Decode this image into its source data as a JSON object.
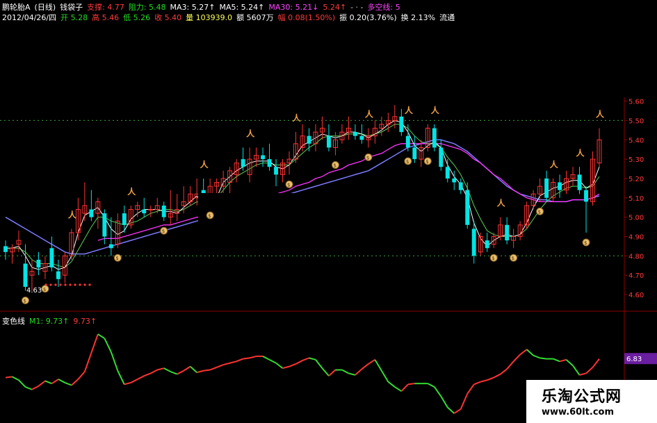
{
  "header": {
    "row1": [
      {
        "text": "鹏轮胎A",
        "color": "#ffffff"
      },
      {
        "text": "(日线)",
        "color": "#ffffff"
      },
      {
        "text": "钱袋子",
        "color": "#ffffff"
      },
      {
        "text": "支撑: 4.77",
        "color": "#ff3b3b"
      },
      {
        "text": "阻力: 5.48",
        "color": "#22dd22"
      },
      {
        "text": "MA3: 5.27↑",
        "color": "#ffffff"
      },
      {
        "text": "MA5: 5.24↑",
        "color": "#ffffff"
      },
      {
        "text": "MA30: 5.21↓",
        "color": "#ff44ff"
      },
      {
        "text": "5.24↑",
        "color": "#ff3b3b"
      },
      {
        "text": "- · -",
        "color": "#cccccc"
      },
      {
        "text": "多空线: 5",
        "color": "#ff44ff"
      }
    ],
    "row2": [
      {
        "text": "2012/04/26/四",
        "color": "#ffffff"
      },
      {
        "text": "开 5.28",
        "color": "#22dd22"
      },
      {
        "text": "高 5.46",
        "color": "#ff3b3b"
      },
      {
        "text": "低 5.26",
        "color": "#22dd22"
      },
      {
        "text": "收 5.40",
        "color": "#ff3b3b"
      },
      {
        "text": "量 103939.0",
        "color": "#ffff55"
      },
      {
        "text": "额 5607万",
        "color": "#ffffff"
      },
      {
        "text": "幅 0.08(1.50%)",
        "color": "#ff3b3b"
      },
      {
        "text": "振 0.20(3.76%)",
        "color": "#ffffff"
      },
      {
        "text": "换 2.13%",
        "color": "#ffffff"
      },
      {
        "text": "流通",
        "color": "#ffffff"
      }
    ]
  },
  "indicator_header": [
    {
      "text": "变色线",
      "color": "#ffffff"
    },
    {
      "text": "M1: 9.73↑",
      "color": "#22dd22"
    },
    {
      "text": "9.73↑",
      "color": "#ff3b3b"
    }
  ],
  "watermark": {
    "title": "乐淘公式网",
    "url": "www.60lt.com"
  },
  "colors": {
    "up": "#ff3333",
    "down": "#00e5e5",
    "ma_white": "#ffffff",
    "ma_green": "#5bd35b",
    "ma_magenta": "#ff33ff",
    "ma_blue": "#7b7bff",
    "grid": "#8b0000"
  },
  "icons": {
    "buy": "running-man-icon",
    "sell": "money-bag-icon"
  },
  "chart_data": [
    {
      "type": "candlestick",
      "title": "",
      "y_ticks": [
        5.6,
        5.5,
        5.4,
        5.3,
        5.2,
        5.1,
        5.0,
        4.9,
        4.8,
        4.7,
        4.6
      ],
      "ylim": [
        4.55,
        5.62
      ],
      "extra_labels": [
        {
          "text": "4.63"
        }
      ],
      "candles": [
        [
          4.85,
          4.88,
          4.78,
          4.82
        ],
        [
          4.82,
          4.86,
          4.76,
          4.84
        ],
        [
          4.86,
          4.93,
          4.82,
          4.88
        ],
        [
          4.76,
          4.86,
          4.62,
          4.64
        ],
        [
          4.7,
          4.78,
          4.62,
          4.72
        ],
        [
          4.78,
          4.82,
          4.7,
          4.74
        ],
        [
          4.72,
          4.8,
          4.68,
          4.76
        ],
        [
          4.84,
          4.9,
          4.72,
          4.74
        ],
        [
          4.72,
          4.78,
          4.64,
          4.68
        ],
        [
          4.7,
          4.82,
          4.66,
          4.8
        ],
        [
          4.8,
          4.94,
          4.78,
          4.92
        ],
        [
          4.92,
          5.1,
          4.88,
          5.04
        ],
        [
          5.02,
          5.18,
          4.98,
          5.06
        ],
        [
          5.04,
          5.14,
          4.98,
          5.0
        ],
        [
          5.02,
          5.1,
          4.94,
          5.08
        ],
        [
          5.02,
          5.04,
          4.86,
          4.9
        ],
        [
          4.86,
          5.0,
          4.8,
          4.84
        ],
        [
          4.86,
          5.02,
          4.84,
          4.98
        ],
        [
          5.02,
          5.06,
          4.92,
          4.96
        ],
        [
          4.96,
          5.06,
          4.94,
          5.04
        ],
        [
          5.04,
          5.08,
          5.0,
          5.06
        ],
        [
          5.04,
          5.1,
          5.0,
          5.02
        ],
        [
          5.04,
          5.06,
          5.0,
          5.04
        ],
        [
          5.04,
          5.1,
          5.02,
          5.06
        ],
        [
          5.06,
          5.08,
          4.98,
          5.0
        ],
        [
          5.0,
          5.14,
          4.96,
          5.02
        ],
        [
          5.02,
          5.12,
          4.98,
          5.04
        ],
        [
          5.06,
          5.16,
          5.02,
          5.08
        ],
        [
          5.08,
          5.16,
          5.06,
          5.12
        ],
        [
          5.1,
          5.2,
          5.06,
          5.12
        ],
        [
          5.14,
          5.2,
          5.04,
          4.96
        ],
        [
          5.1,
          5.2,
          5.06,
          5.16
        ],
        [
          5.16,
          5.2,
          5.12,
          5.18
        ],
        [
          5.16,
          5.24,
          5.12,
          5.2
        ],
        [
          5.18,
          5.26,
          5.1,
          5.24
        ],
        [
          5.22,
          5.3,
          5.18,
          5.28
        ],
        [
          5.3,
          5.36,
          5.24,
          5.26
        ],
        [
          5.22,
          5.36,
          5.18,
          5.3
        ],
        [
          5.3,
          5.36,
          5.26,
          5.32
        ],
        [
          5.32,
          5.36,
          5.26,
          5.3
        ],
        [
          5.3,
          5.38,
          5.24,
          5.26
        ],
        [
          5.26,
          5.3,
          5.16,
          5.22
        ],
        [
          5.22,
          5.3,
          5.18,
          5.28
        ],
        [
          5.28,
          5.34,
          5.22,
          5.3
        ],
        [
          5.3,
          5.44,
          5.28,
          5.38
        ],
        [
          5.36,
          5.48,
          5.34,
          5.42
        ],
        [
          5.42,
          5.46,
          5.34,
          5.38
        ],
        [
          5.38,
          5.48,
          5.34,
          5.44
        ],
        [
          5.44,
          5.52,
          5.4,
          5.46
        ],
        [
          5.42,
          5.48,
          5.34,
          5.36
        ],
        [
          5.36,
          5.44,
          5.32,
          5.4
        ],
        [
          5.4,
          5.48,
          5.38,
          5.44
        ],
        [
          5.44,
          5.52,
          5.4,
          5.46
        ],
        [
          5.44,
          5.48,
          5.4,
          5.42
        ],
        [
          5.42,
          5.48,
          5.38,
          5.4
        ],
        [
          5.4,
          5.46,
          5.36,
          5.42
        ],
        [
          5.42,
          5.5,
          5.38,
          5.46
        ],
        [
          5.46,
          5.52,
          5.42,
          5.48
        ],
        [
          5.48,
          5.54,
          5.44,
          5.5
        ],
        [
          5.5,
          5.58,
          5.46,
          5.52
        ],
        [
          5.52,
          5.56,
          5.42,
          5.44
        ],
        [
          5.42,
          5.48,
          5.34,
          5.36
        ],
        [
          5.36,
          5.42,
          5.28,
          5.3
        ],
        [
          5.3,
          5.4,
          5.26,
          5.36
        ],
        [
          5.36,
          5.48,
          5.34,
          5.46
        ],
        [
          5.46,
          5.48,
          5.34,
          5.36
        ],
        [
          5.36,
          5.4,
          5.24,
          5.26
        ],
        [
          5.26,
          5.3,
          5.18,
          5.2
        ],
        [
          5.2,
          5.24,
          5.14,
          5.18
        ],
        [
          5.18,
          5.2,
          5.12,
          5.14
        ],
        [
          5.14,
          5.18,
          4.94,
          4.96
        ],
        [
          4.94,
          4.98,
          4.76,
          4.8
        ],
        [
          4.82,
          4.92,
          4.8,
          4.9
        ],
        [
          4.88,
          4.92,
          4.82,
          4.84
        ],
        [
          4.86,
          4.92,
          4.84,
          4.9
        ],
        [
          4.9,
          5.0,
          4.88,
          4.96
        ],
        [
          4.96,
          5.0,
          4.86,
          4.88
        ],
        [
          4.88,
          4.94,
          4.84,
          4.9
        ],
        [
          4.9,
          4.98,
          4.88,
          4.96
        ],
        [
          4.96,
          5.08,
          4.94,
          5.06
        ],
        [
          5.06,
          5.14,
          5.04,
          5.12
        ],
        [
          5.12,
          5.2,
          5.08,
          5.16
        ],
        [
          5.2,
          5.24,
          5.08,
          5.1
        ],
        [
          5.1,
          5.2,
          5.08,
          5.18
        ],
        [
          5.18,
          5.22,
          5.1,
          5.14
        ],
        [
          5.14,
          5.24,
          5.12,
          5.2
        ],
        [
          5.2,
          5.26,
          5.16,
          5.22
        ],
        [
          5.22,
          5.26,
          5.12,
          5.14
        ],
        [
          5.14,
          5.16,
          4.92,
          5.08
        ],
        [
          5.08,
          5.34,
          5.06,
          5.3
        ],
        [
          5.28,
          5.46,
          5.26,
          5.4
        ]
      ],
      "ma_white": [
        4.84,
        4.84,
        4.85,
        4.8,
        4.74,
        4.73,
        4.74,
        4.75,
        4.73,
        4.74,
        4.8,
        4.92,
        5.01,
        5.03,
        5.05,
        5.0,
        4.94,
        4.91,
        4.93,
        4.99,
        5.02,
        5.04,
        5.04,
        5.04,
        5.03,
        5.03,
        5.02,
        5.05,
        5.08,
        5.11,
        5.07,
        5.08,
        5.1,
        5.18,
        5.21,
        5.24,
        5.26,
        5.28,
        5.29,
        5.29,
        5.29,
        5.26,
        5.25,
        5.27,
        5.32,
        5.37,
        5.39,
        5.41,
        5.43,
        5.42,
        5.41,
        5.42,
        5.44,
        5.44,
        5.43,
        5.41,
        5.43,
        5.45,
        5.48,
        5.5,
        5.49,
        5.44,
        5.37,
        5.34,
        5.37,
        5.39,
        5.36,
        5.27,
        5.21,
        5.17,
        5.1,
        4.97,
        4.89,
        4.85,
        4.88,
        4.9,
        4.91,
        4.9,
        4.91,
        4.97,
        5.05,
        5.11,
        5.13,
        5.15,
        5.16,
        5.18,
        5.19,
        5.19,
        5.15,
        5.17,
        5.26
      ],
      "ma_green": [
        4.84,
        4.84,
        4.84,
        4.82,
        4.78,
        4.76,
        4.76,
        4.76,
        4.75,
        4.74,
        4.77,
        4.83,
        4.89,
        4.95,
        5.0,
        5.0,
        4.98,
        4.97,
        4.96,
        4.97,
        4.98,
        5.0,
        5.02,
        5.03,
        5.04,
        5.04,
        5.03,
        5.04,
        5.06,
        5.08,
        5.07,
        5.08,
        5.1,
        5.14,
        5.18,
        5.21,
        5.23,
        5.25,
        5.27,
        5.28,
        5.28,
        5.27,
        5.27,
        5.27,
        5.3,
        5.33,
        5.36,
        5.38,
        5.41,
        5.42,
        5.42,
        5.42,
        5.43,
        5.43,
        5.43,
        5.42,
        5.43,
        5.44,
        5.46,
        5.48,
        5.48,
        5.46,
        5.42,
        5.39,
        5.38,
        5.38,
        5.36,
        5.31,
        5.27,
        5.22,
        5.15,
        5.06,
        4.99,
        4.93,
        4.91,
        4.9,
        4.9,
        4.9,
        4.91,
        4.94,
        4.99,
        5.04,
        5.08,
        5.11,
        5.13,
        5.15,
        5.16,
        5.16,
        5.15,
        5.16,
        5.21
      ],
      "ma_magenta": [
        null,
        null,
        null,
        null,
        null,
        null,
        null,
        null,
        null,
        null,
        null,
        null,
        null,
        null,
        4.88,
        4.89,
        4.89,
        4.89,
        4.9,
        4.91,
        4.92,
        4.93,
        4.94,
        4.95,
        4.96,
        4.96,
        4.97,
        4.98,
        4.99,
        5.0,
        5.0,
        5.01,
        5.02,
        5.03,
        5.04,
        5.05,
        5.06,
        5.07,
        5.09,
        5.1,
        5.11,
        5.12,
        5.13,
        5.14,
        5.16,
        5.17,
        5.18,
        5.2,
        5.21,
        5.23,
        5.24,
        5.25,
        5.27,
        5.28,
        5.29,
        5.31,
        5.32,
        5.33,
        5.35,
        5.37,
        5.38,
        5.38,
        5.38,
        5.38,
        5.38,
        5.38,
        5.38,
        5.37,
        5.36,
        5.35,
        5.33,
        5.3,
        5.28,
        5.25,
        5.22,
        5.2,
        5.17,
        5.14,
        5.12,
        5.1,
        5.09,
        5.08,
        5.08,
        5.08,
        5.08,
        5.08,
        5.09,
        5.09,
        5.09,
        5.1,
        5.12
      ],
      "ma_blue": [
        5.0,
        4.98,
        4.96,
        4.94,
        4.92,
        4.9,
        4.88,
        4.86,
        4.84,
        4.82,
        4.81,
        4.81,
        4.81,
        4.82,
        4.83,
        4.84,
        4.85,
        4.86,
        4.87,
        4.88,
        4.89,
        4.9,
        4.91,
        4.92,
        4.93,
        4.94,
        4.95,
        4.96,
        4.97,
        4.98,
        4.99,
        5.0,
        5.01,
        5.02,
        5.03,
        5.04,
        5.05,
        5.06,
        5.07,
        5.08,
        5.09,
        5.1,
        5.11,
        5.12,
        5.13,
        5.14,
        5.15,
        5.16,
        5.17,
        5.18,
        5.19,
        5.2,
        5.21,
        5.22,
        5.23,
        5.24,
        5.26,
        5.28,
        5.3,
        5.32,
        5.34,
        5.36,
        5.37,
        5.38,
        5.39,
        5.4,
        5.4,
        5.39,
        5.38,
        5.36,
        5.34,
        5.31,
        5.28,
        5.25,
        5.22,
        5.19,
        5.16,
        5.14,
        5.12,
        5.11,
        5.1,
        5.09,
        5.09,
        5.08,
        5.08,
        5.08,
        5.09,
        5.09,
        5.09,
        5.1,
        5.11
      ],
      "buy_markers": [
        10,
        19,
        30,
        37,
        44,
        55,
        61,
        65,
        75,
        83,
        87,
        90
      ],
      "sell_markers": [
        3,
        6,
        17,
        24,
        31,
        43,
        50,
        55,
        61,
        64,
        74,
        77,
        81,
        88
      ]
    },
    {
      "type": "line",
      "title": "变色线",
      "ylim": [
        0,
        10.6
      ],
      "current_label": "6.83",
      "values": [
        4.6,
        4.7,
        4.3,
        3.5,
        3.2,
        3.6,
        4.2,
        3.9,
        4.4,
        4.0,
        3.7,
        4.4,
        5.3,
        7.5,
        9.7,
        9.2,
        7.6,
        5.4,
        3.8,
        4.0,
        4.4,
        4.8,
        5.1,
        5.5,
        5.7,
        5.3,
        5.0,
        5.4,
        5.9,
        5.2,
        5.4,
        5.5,
        5.8,
        6.1,
        6.3,
        6.5,
        6.8,
        6.9,
        7.1,
        7.1,
        6.7,
        6.3,
        5.7,
        5.9,
        6.2,
        6.6,
        6.9,
        6.7,
        5.7,
        4.8,
        5.5,
        5.5,
        5.1,
        4.9,
        5.6,
        6.2,
        6.7,
        5.4,
        4.1,
        3.5,
        3.0,
        3.8,
        3.9,
        3.9,
        3.9,
        3.5,
        2.4,
        1.1,
        0.4,
        0.9,
        2.7,
        3.8,
        4.1,
        4.3,
        4.6,
        5.0,
        5.6,
        6.5,
        7.3,
        7.9,
        7.2,
        6.9,
        6.8,
        6.8,
        6.5,
        6.7,
        6.0,
        4.9,
        5.1,
        5.8,
        6.8
      ],
      "up_flags": [
        1,
        1,
        0,
        0,
        0,
        1,
        1,
        0,
        1,
        0,
        0,
        1,
        1,
        1,
        1,
        0,
        0,
        0,
        0,
        1,
        1,
        1,
        1,
        1,
        1,
        0,
        0,
        1,
        1,
        0,
        1,
        1,
        1,
        1,
        1,
        1,
        1,
        1,
        1,
        1,
        0,
        0,
        0,
        1,
        1,
        1,
        1,
        0,
        0,
        0,
        1,
        0,
        0,
        0,
        1,
        1,
        1,
        0,
        0,
        0,
        0,
        1,
        1,
        0,
        0,
        0,
        0,
        0,
        0,
        1,
        1,
        1,
        1,
        1,
        1,
        1,
        1,
        1,
        1,
        1,
        0,
        0,
        0,
        0,
        0,
        1,
        0,
        0,
        1,
        1,
        1
      ]
    }
  ]
}
